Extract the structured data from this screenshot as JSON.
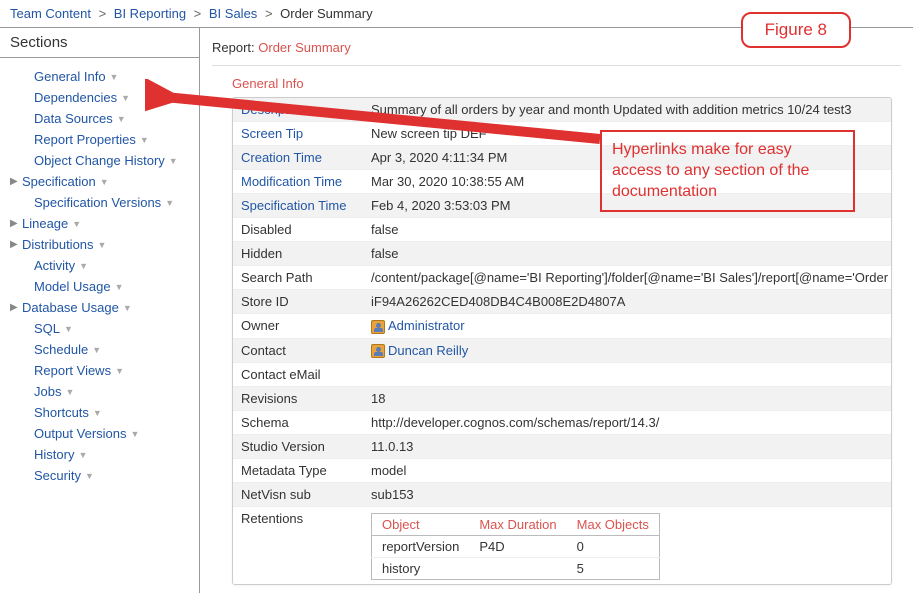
{
  "breadcrumb": {
    "items": [
      "Team Content",
      "BI Reporting",
      "BI Sales"
    ],
    "current": "Order Summary"
  },
  "sidebar": {
    "header": "Sections",
    "items": [
      {
        "label": "General Info",
        "caret": false,
        "indent": true
      },
      {
        "label": "Dependencies",
        "caret": false,
        "indent": true
      },
      {
        "label": "Data Sources",
        "caret": false,
        "indent": true
      },
      {
        "label": "Report Properties",
        "caret": false,
        "indent": true
      },
      {
        "label": "Object Change History",
        "caret": false,
        "indent": true
      },
      {
        "label": "Specification",
        "caret": true,
        "indent": false
      },
      {
        "label": "Specification Versions",
        "caret": false,
        "indent": true
      },
      {
        "label": "Lineage",
        "caret": true,
        "indent": false
      },
      {
        "label": "Distributions",
        "caret": true,
        "indent": false
      },
      {
        "label": "Activity",
        "caret": false,
        "indent": true
      },
      {
        "label": "Model Usage",
        "caret": false,
        "indent": true
      },
      {
        "label": "Database Usage",
        "caret": true,
        "indent": false
      },
      {
        "label": "SQL",
        "caret": false,
        "indent": true
      },
      {
        "label": "Schedule",
        "caret": false,
        "indent": true
      },
      {
        "label": "Report Views",
        "caret": false,
        "indent": true
      },
      {
        "label": "Jobs",
        "caret": false,
        "indent": true
      },
      {
        "label": "Shortcuts",
        "caret": false,
        "indent": true
      },
      {
        "label": "Output Versions",
        "caret": false,
        "indent": true
      },
      {
        "label": "History",
        "caret": false,
        "indent": true
      },
      {
        "label": "Security",
        "caret": false,
        "indent": true
      }
    ]
  },
  "content": {
    "report_lbl": "Report:",
    "report_name": "Order Summary",
    "section_title": "General Info",
    "rows": [
      {
        "label": "Description",
        "value": "Summary of all orders by year and month Updated with addition metrics 10/24 test3"
      },
      {
        "label": "Screen Tip",
        "value": "New screen tip DEF",
        "obscured": true
      },
      {
        "label": "Creation Time",
        "value": "Apr 3, 2020 4:11:34 PM",
        "obscured_partial": true
      },
      {
        "label": "Modification Time",
        "value": "Mar 30, 2020 10:38:55 AM"
      },
      {
        "label": "Specification Time",
        "value": "Feb 4, 2020 3:53:03 PM"
      },
      {
        "label": "Disabled",
        "value": "false",
        "plain": true
      },
      {
        "label": "Hidden",
        "value": "false",
        "plain": true
      },
      {
        "label": "Search Path",
        "value": "/content/package[@name='BI Reporting']/folder[@name='BI Sales']/report[@name='Order",
        "plain": true
      },
      {
        "label": "Store ID",
        "value": "iF94A26262CED408DB4C4B008E2D4807A",
        "plain": true
      },
      {
        "label": "Owner",
        "value": "Administrator",
        "plain": true,
        "person": true,
        "link": true
      },
      {
        "label": "Contact",
        "value": "Duncan Reilly",
        "plain": true,
        "person": true,
        "link": true
      },
      {
        "label": "Contact eMail",
        "value": "",
        "plain": true
      },
      {
        "label": "Revisions",
        "value": "18",
        "plain": true
      },
      {
        "label": "Schema",
        "value": "http://developer.cognos.com/schemas/report/14.3/",
        "plain": true
      },
      {
        "label": "Studio Version",
        "value": "11.0.13",
        "plain": true
      },
      {
        "label": "Metadata Type",
        "value": "model",
        "plain": true
      },
      {
        "label": "NetVisn sub",
        "value": "sub153",
        "plain": true
      }
    ],
    "retentions": {
      "label": "Retentions",
      "headers": [
        "Object",
        "Max Duration",
        "Max Objects"
      ],
      "rows": [
        {
          "object": "reportVersion",
          "max_duration": "P4D",
          "max_objects": "0"
        },
        {
          "object": "history",
          "max_duration": "",
          "max_objects": "5"
        }
      ]
    }
  },
  "annotations": {
    "figure": "Figure 8",
    "callout": "Hyperlinks make for easy access to any section of the documentation"
  }
}
